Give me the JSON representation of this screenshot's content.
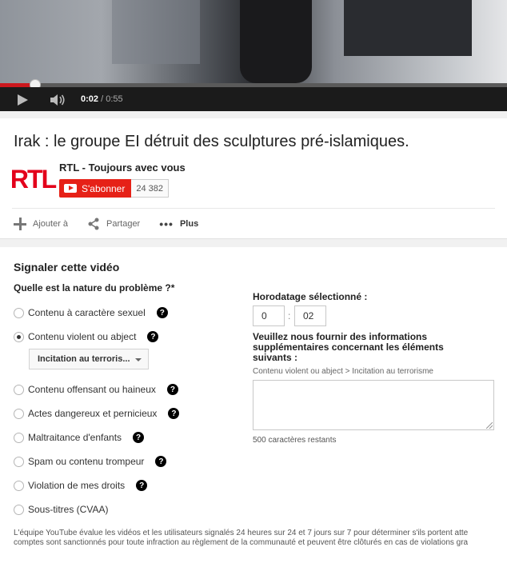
{
  "player": {
    "current_time": "0:02",
    "duration": "/ 0:55",
    "progress_fraction": 0.07,
    "accent": "#cc181e"
  },
  "video": {
    "title": "Irak : le groupe EI détruit des sculptures pré-islamiques.",
    "channel_logo_text": "RTL",
    "channel_name": "RTL - Toujours avec vous",
    "subscribe_label": "S'abonner",
    "subscriber_count": "24 382",
    "actions": {
      "add_label": "Ajouter à",
      "share_label": "Partager",
      "more_label": "Plus"
    }
  },
  "report": {
    "title": "Signaler cette vidéo",
    "question": "Quelle est la nature du problème ?*",
    "options": [
      {
        "label": "Contenu à caractère sexuel",
        "help": "?"
      },
      {
        "label": "Contenu violent ou abject",
        "help": "?"
      },
      {
        "label": "Contenu offensant ou haineux",
        "help": "?"
      },
      {
        "label": "Actes dangereux et pernicieux",
        "help": "?"
      },
      {
        "label": "Maltraitance d'enfants",
        "help": "?"
      },
      {
        "label": "Spam ou contenu trompeur",
        "help": "?"
      },
      {
        "label": "Violation de mes droits",
        "help": "?"
      },
      {
        "label": "Sous-titres (CVAA)"
      }
    ],
    "selected_option": "Contenu violent ou abject",
    "subcategory_value": "Incitation au terroris...",
    "timestamp_label": "Horodatage sélectionné :",
    "timestamp_minutes": "0",
    "timestamp_separator": ":",
    "timestamp_seconds": "02",
    "more_info_label": "Veuillez nous fournir des informations supplémentaires concernant les éléments suivants :",
    "category_path": "Contenu violent ou abject > Incitation au terrorisme",
    "details_value": "",
    "chars_remaining": "500 caractères restants",
    "footer_line1": "L'équipe YouTube évalue les vidéos et les utilisateurs signalés 24 heures sur 24 et 7 jours sur 7 pour déterminer s'ils portent atte",
    "footer_line2": "comptes sont sanctionnés pour toute infraction au règlement de la communauté et peuvent être clôturés en cas de violations gra"
  }
}
